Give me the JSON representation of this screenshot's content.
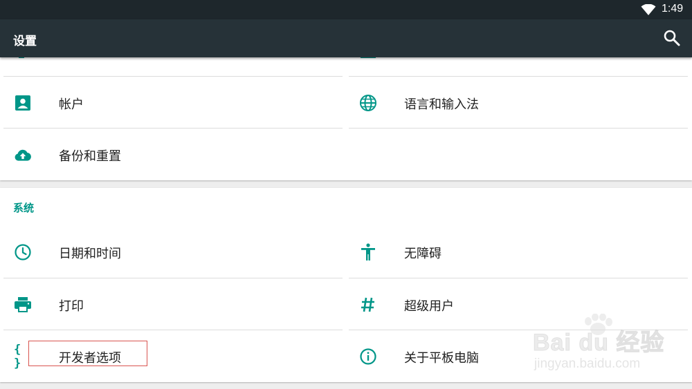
{
  "status_bar": {
    "time": "1:49"
  },
  "app_bar": {
    "title": "设置"
  },
  "personal": {
    "items": [
      {
        "label": "帐户",
        "icon": "account-box-icon"
      },
      {
        "label": "语言和输入法",
        "icon": "globe-icon"
      },
      {
        "label": "备份和重置",
        "icon": "cloud-upload-icon"
      }
    ]
  },
  "system": {
    "title": "系统",
    "items": [
      {
        "label": "日期和时间",
        "icon": "clock-icon"
      },
      {
        "label": "无障碍",
        "icon": "accessibility-icon"
      },
      {
        "label": "打印",
        "icon": "printer-icon"
      },
      {
        "label": "超级用户",
        "icon": "hash-icon"
      },
      {
        "label": "开发者选项",
        "icon": "braces-icon"
      },
      {
        "label": "关于平板电脑",
        "icon": "info-icon"
      }
    ]
  },
  "watermark": {
    "main": "Bai du 经验",
    "sub": "jingyan.baidu.com"
  },
  "colors": {
    "accent": "#009688",
    "app_bar": "#263238",
    "status_bar": "#1e272c"
  }
}
